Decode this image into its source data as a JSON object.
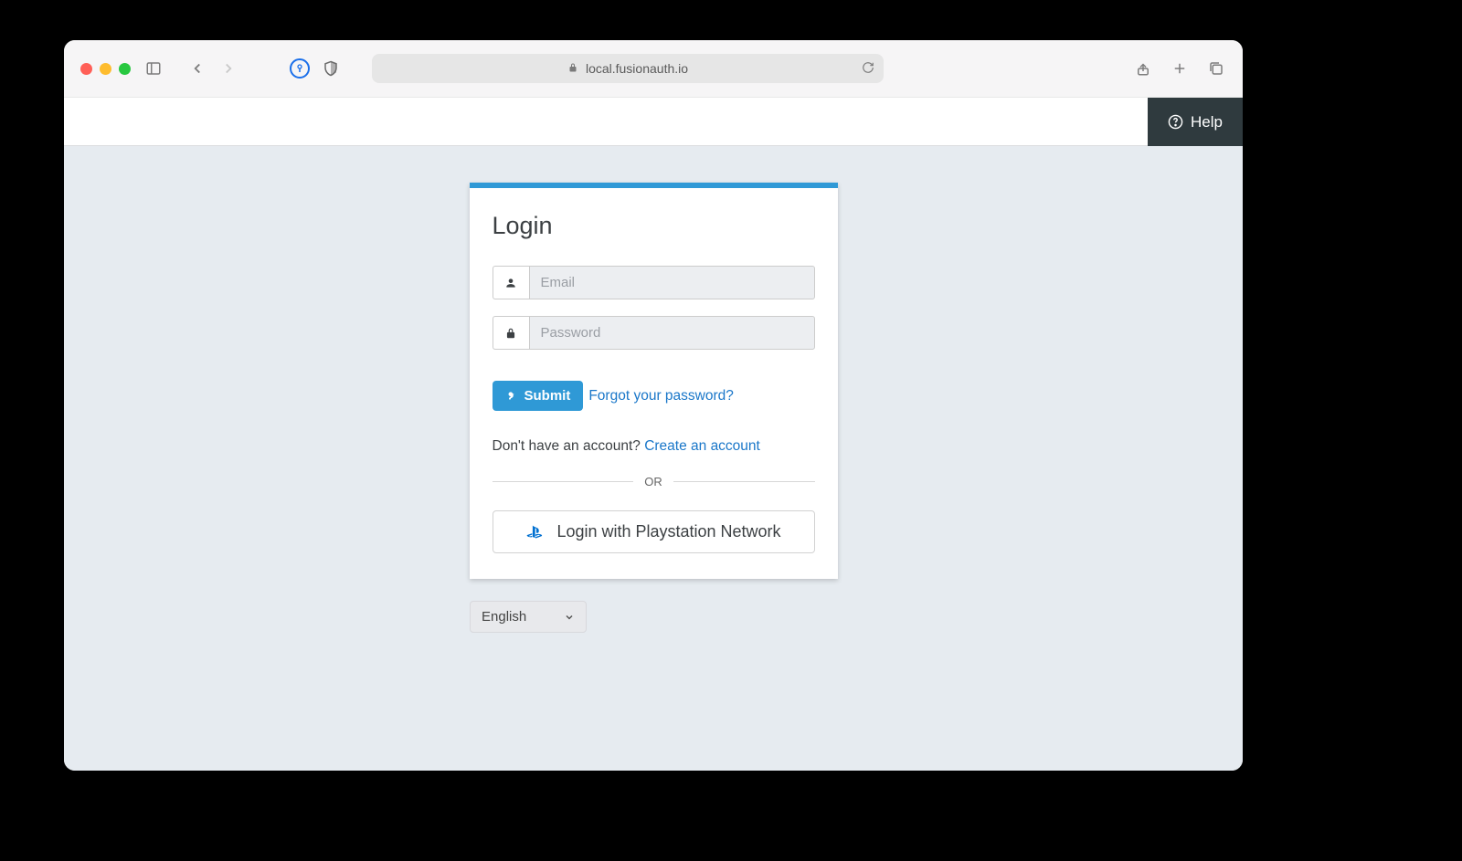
{
  "browser": {
    "url": "local.fusionauth.io"
  },
  "header": {
    "help_label": "Help"
  },
  "login": {
    "title": "Login",
    "email_placeholder": "Email",
    "email_value": "",
    "password_placeholder": "Password",
    "password_value": "",
    "submit_label": "Submit",
    "forgot_label": "Forgot your password?",
    "signup_prompt": "Don't have an account? ",
    "signup_link": "Create an account",
    "or_label": "OR",
    "sso_label": "Login with Playstation Network"
  },
  "language": {
    "selected": "English"
  }
}
